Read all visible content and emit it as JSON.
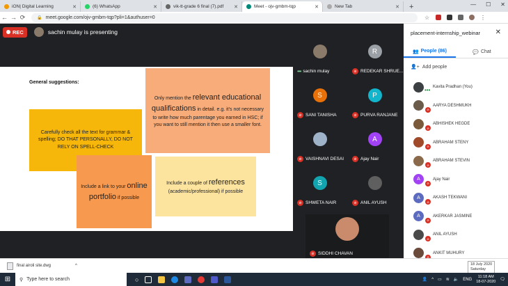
{
  "browser": {
    "tabs": [
      {
        "label": "iON| Digital Learning",
        "color": "#f29900"
      },
      {
        "label": "(6) WhatsApp",
        "color": "#25d366"
      },
      {
        "label": "vik-tt-grade 6 final (7).pdf",
        "color": "#666666"
      },
      {
        "label": "Meet - ojv-gmbm-tqp",
        "color": "#00897b",
        "active": true
      },
      {
        "label": "New Tab",
        "color": "#aaaaaa"
      }
    ],
    "new_tab": "+",
    "url": "meet.google.com/ojv-gmbm-tqp?pli=1&authuser=0",
    "min": "—",
    "max": "☐",
    "close": "✕"
  },
  "meet": {
    "rec_label": "REC",
    "presenting": "sachin mulay is presenting"
  },
  "slide": {
    "heading": "General suggestions:",
    "box1": "Carefully check all the text for grammar & spelling; DO THAT PERSONALLY, DO NOT RELY ON SPELL-CHECK",
    "box2_pre": "Only mention the ",
    "box2_big": "relevant educational qualifications",
    "box2_post": " in detail. e.g. it’s not necessary to write how much parentage you earned in HSC; if you want to still mention it then use a smaller font.",
    "box3_pre": "Include a link to your ",
    "box3_big": "online portfolio",
    "box3_post": " if possible",
    "box4_pre": "Include a couple of ",
    "box4_big": "references",
    "box4_post": " (academic/professional) if possible"
  },
  "tiles": [
    {
      "name": "sachin mulay",
      "initial": "",
      "color": "#8a7a6a",
      "photo": true,
      "dots": "•••"
    },
    {
      "name": "REDEKAR SHRUE...",
      "initial": "R",
      "color": "#9aa0a6"
    },
    {
      "name": "SANI TANISHA",
      "initial": "S",
      "color": "#e8710a"
    },
    {
      "name": "PURVA RANJANE",
      "initial": "P",
      "color": "#12b5cb"
    },
    {
      "name": "VAISHNAVI DESAI",
      "initial": "",
      "color": "#9fb3c8",
      "photo": true
    },
    {
      "name": "Ajay Nair",
      "initial": "A",
      "color": "#a142f4"
    },
    {
      "name": "SHWETA NAIR",
      "initial": "S",
      "color": "#12a4af"
    },
    {
      "name": "ANIL AYUSH",
      "initial": "",
      "color": "#5f5f5f",
      "photo": true
    },
    {
      "name": "SIDDHI CHAVAN",
      "initial": "",
      "color": "#c98b6b",
      "photo": true
    }
  ],
  "panel": {
    "title": "placement-internship_webinar",
    "close": "✕",
    "tab_people": "People (86)",
    "tab_chat": "Chat",
    "add_people": "Add people",
    "people": [
      {
        "name": "Kavita Pradhan (You)",
        "initial": "",
        "color": "#3c4043",
        "you": true
      },
      {
        "name": "AARYA DESHMUKH",
        "initial": "",
        "color": "#6b5b4b"
      },
      {
        "name": "ABHISHEK HEGDE",
        "initial": "",
        "color": "#7a5a3a"
      },
      {
        "name": "ABRAHAM STENY",
        "initial": "",
        "color": "#a04a2a"
      },
      {
        "name": "ABRAHAM STEVIN",
        "initial": "",
        "color": "#8a6a4a"
      },
      {
        "name": "Ajay Nair",
        "initial": "A",
        "color": "#a142f4"
      },
      {
        "name": "AKASH TEKWANI",
        "initial": "A",
        "color": "#5c6bc0"
      },
      {
        "name": "AKERKAR JASMINE",
        "initial": "A",
        "color": "#5c6bc0"
      },
      {
        "name": "ANIL AYUSH",
        "initial": "",
        "color": "#4a4a4a"
      },
      {
        "name": "ANKIT MUHURY",
        "initial": "",
        "color": "#6a4a3a"
      }
    ]
  },
  "download": {
    "file": "final airoli site.dwg"
  },
  "taskbar": {
    "search": "Type here to search",
    "time": "11:18 AM",
    "date": "18-07-2020",
    "lang": "ENG",
    "tooltip_line1": "18 July 2020",
    "tooltip_line2": "Saturday"
  }
}
